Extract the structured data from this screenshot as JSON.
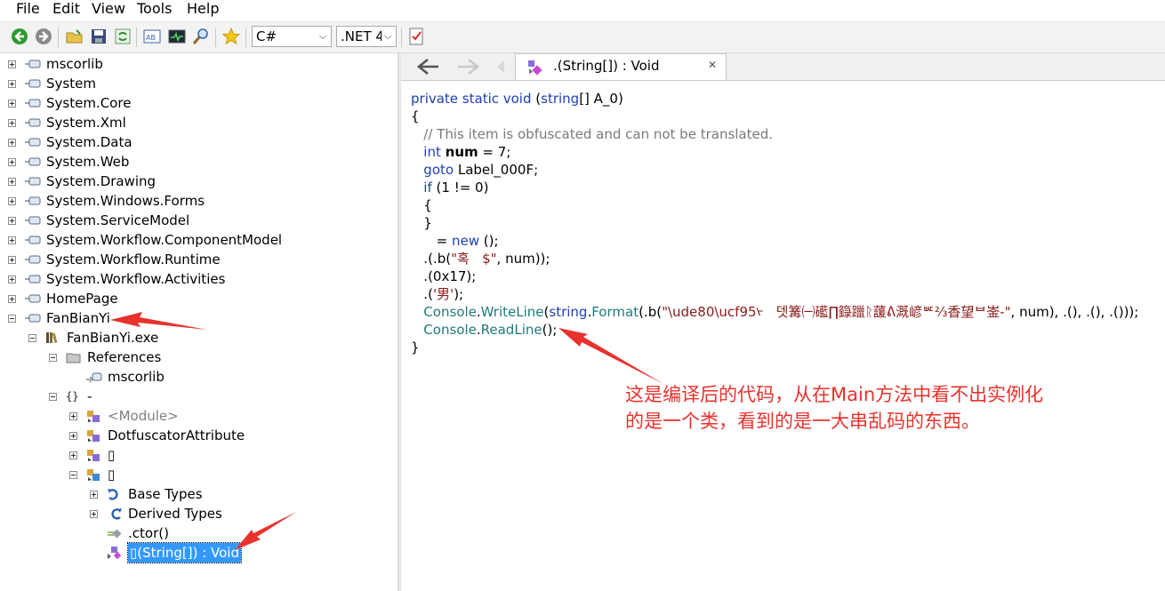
{
  "menu": [
    "File",
    "Edit",
    "View",
    "Tools",
    "Help"
  ],
  "toolbar": {
    "language": "C#",
    "framework": ".NET 4",
    "buttons": [
      "back-icon",
      "forward-icon",
      "open-icon",
      "save-icon",
      "refresh-icon",
      "text-view-icon",
      "console-icon",
      "search-icon",
      "favorite-icon",
      "analyze-icon"
    ]
  },
  "tree": {
    "assemblies": [
      "mscorlib",
      "System",
      "System.Core",
      "System.Xml",
      "System.Data",
      "System.Web",
      "System.Drawing",
      "System.Windows.Forms",
      "System.ServiceModel",
      "System.Workflow.ComponentModel",
      "System.Workflow.Runtime",
      "System.Workflow.Activities",
      "HomePage",
      "FanBianYi"
    ],
    "module": "FanBianYi.exe",
    "references": "References",
    "reference_item": "mscorlib",
    "namespace": "-",
    "namespace_icon_text": "{}",
    "types": [
      "<Module>",
      "DotfuscatorAttribute",
      "▯",
      "▯"
    ],
    "members": [
      "Base Types",
      "Derived Types",
      ".ctor()"
    ],
    "selected": "▯(String[]) : Void"
  },
  "tab": {
    "title": ".(String[]) : Void",
    "close": "✕"
  },
  "code": [
    {
      "parts": [
        [
          "kw",
          "private static void "
        ],
        [
          "",
          "("
        ],
        [
          "kw",
          "string"
        ],
        [
          "",
          "[] A_0)"
        ]
      ]
    },
    {
      "parts": [
        [
          "",
          "{"
        ]
      ]
    },
    {
      "parts": [
        [
          "cm",
          "   // This item is obfuscated and can not be translated."
        ]
      ]
    },
    {
      "parts": [
        [
          "kw",
          "   int "
        ],
        [
          "b",
          "num"
        ],
        [
          "",
          " = 7;"
        ]
      ]
    },
    {
      "parts": [
        [
          "kw",
          "   goto "
        ],
        [
          "",
          "Label_000F;"
        ]
      ]
    },
    {
      "parts": [
        [
          "kw",
          "   if "
        ],
        [
          "",
          "(1 != 0)"
        ]
      ]
    },
    {
      "parts": [
        [
          "",
          "   {"
        ]
      ]
    },
    {
      "parts": [
        [
          "",
          "   }"
        ]
      ]
    },
    {
      "parts": [
        [
          "",
          "      = "
        ],
        [
          "kw",
          "new "
        ],
        [
          "",
          "();"
        ]
      ]
    },
    {
      "parts": [
        [
          "",
          "   .(.b("
        ],
        [
          "st",
          "\"혹   $\""
        ],
        [
          "",
          ", num));"
        ]
      ]
    },
    {
      "parts": [
        [
          "",
          "   .(0x17);"
        ]
      ]
    },
    {
      "parts": [
        [
          "",
          "   .("
        ],
        [
          "st",
          "'男'"
        ],
        [
          "",
          ");"
        ]
      ]
    },
    {
      "parts": [
        [
          "ty",
          "   Console"
        ],
        [
          "",
          "."
        ],
        [
          "ty",
          "WriteLine"
        ],
        [
          "",
          "("
        ],
        [
          "kw",
          "string"
        ],
        [
          "",
          "."
        ],
        [
          "ty",
          "Format"
        ],
        [
          "",
          "(.b("
        ],
        [
          "st",
          "\"\\ude80\\ucf95ᢣ   뎃篝㈠礷∏籙躐ᚱ蘐ᕕ溉嵃ᄣ⅔香望ᄇ崟-\""
        ],
        [
          "",
          ", num), .(), .(), .()));"
        ]
      ]
    },
    {
      "parts": [
        [
          "ty",
          "   Console"
        ],
        [
          "",
          "."
        ],
        [
          "ty",
          "ReadLine"
        ],
        [
          "",
          "();"
        ]
      ]
    },
    {
      "parts": [
        [
          "",
          "}"
        ]
      ]
    }
  ],
  "annotation": {
    "line1": "这是编译后的代码，从在Main方法中看不出实例化",
    "line2": "的是一个类，看到的是一大串乱码的东西。"
  },
  "colors": {
    "accent_red": "#e8322d",
    "selection": "#3399ff",
    "keyword": "#1e3fb4",
    "type": "#1f7a7a"
  }
}
